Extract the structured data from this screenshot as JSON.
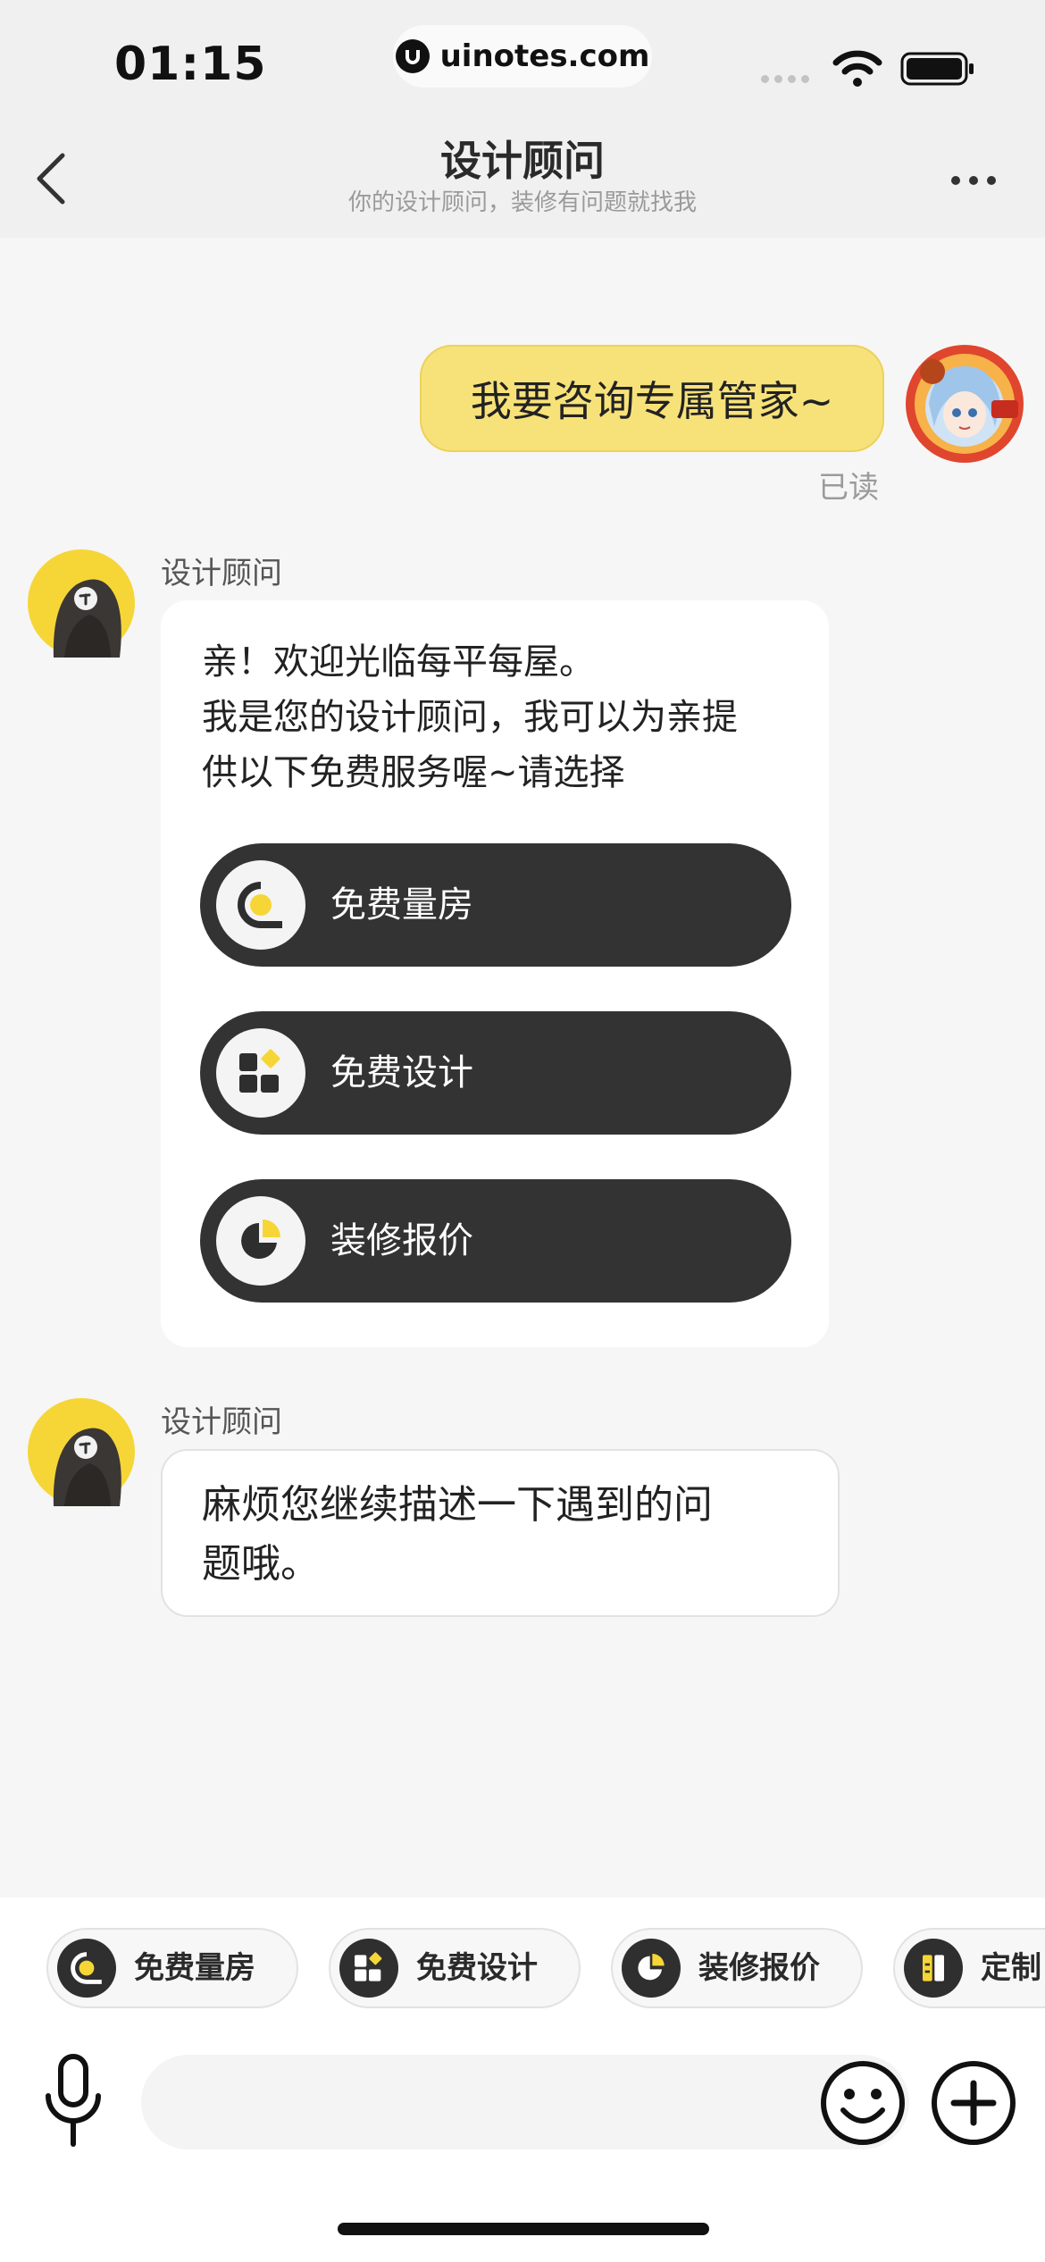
{
  "status_bar": {
    "time": "01:15",
    "url": "uinotes.com"
  },
  "nav": {
    "title": "设计顾问",
    "subtitle": "你的设计顾问，装修有问题就找我"
  },
  "messages": {
    "user_message": "我要咨询专属管家~",
    "read_status": "已读",
    "bot_name_1": "设计顾问",
    "card_lines": [
      "亲！欢迎光临每平每屋。",
      "我是您的设计顾问，我可以为亲提",
      "供以下免费服务喔~请选择"
    ],
    "options": [
      {
        "label": "免费量房",
        "icon": "tape-measure-icon"
      },
      {
        "label": "免费设计",
        "icon": "grid-design-icon"
      },
      {
        "label": "装修报价",
        "icon": "pie-chart-icon"
      }
    ],
    "bot_name_2": "设计顾问",
    "bot_reply_lines": [
      "麻烦您继续描述一下遇到的问",
      "题哦。"
    ]
  },
  "quick_replies": [
    {
      "label": "免费量房",
      "icon": "tape-measure-icon"
    },
    {
      "label": "免费设计",
      "icon": "grid-design-icon"
    },
    {
      "label": "装修报价",
      "icon": "pie-chart-icon"
    },
    {
      "label": "定制",
      "icon": "custom-furniture-icon"
    }
  ],
  "input": {
    "placeholder": ""
  },
  "colors": {
    "accent_yellow": "#f7e27a",
    "dark_button": "#333333",
    "background": "#f6f6f6"
  }
}
